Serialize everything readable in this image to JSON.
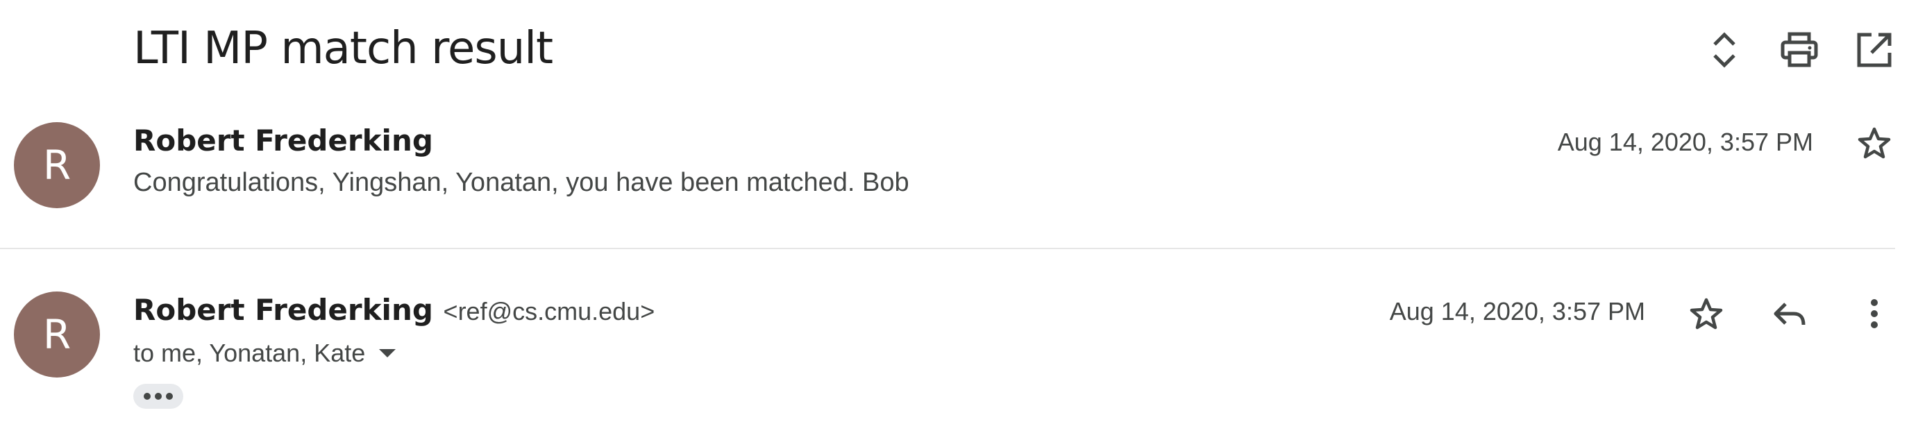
{
  "subject": "LTI MP match result",
  "toolbar": {
    "expand_icon": "unfold-more-icon",
    "print_icon": "print-icon",
    "open_new_window_icon": "open-in-new-icon"
  },
  "messages": [
    {
      "avatar_letter": "R",
      "avatar_color": "#8d6b63",
      "sender_name": "Robert Frederking",
      "date": "Aug 14, 2020, 3:57 PM",
      "snippet": "Congratulations, Yingshan, Yonatan, you have been matched. Bob"
    },
    {
      "avatar_letter": "R",
      "avatar_color": "#8d6b63",
      "sender_name": "Robert Frederking",
      "sender_email": "<ref@cs.cmu.edu>",
      "date": "Aug 14, 2020, 3:57 PM",
      "recipients": "to me, Yonatan, Kate"
    }
  ]
}
